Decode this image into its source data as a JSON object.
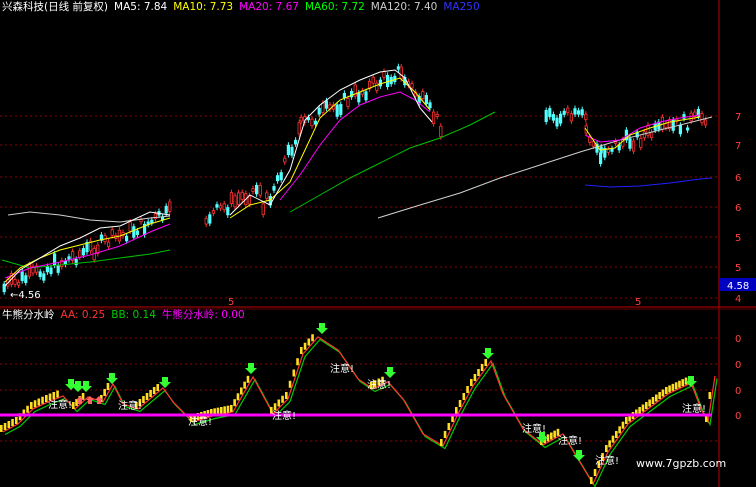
{
  "main_legend": {
    "stock": "兴森科技(日线 前复权)",
    "ma": [
      {
        "label": "MA5:",
        "value": "7.84",
        "color": "#ffffff"
      },
      {
        "label": "MA10:",
        "value": "7.73",
        "color": "#ffff00"
      },
      {
        "label": "MA20:",
        "value": "7.67",
        "color": "#ff00ff"
      },
      {
        "label": "MA60:",
        "value": "7.72",
        "color": "#00ff00"
      },
      {
        "label": "MA120:",
        "value": "7.40",
        "color": "#cccccc"
      },
      {
        "label": "MA250",
        "value": "",
        "color": "#3333ff"
      }
    ]
  },
  "price_axis": {
    "ticks": [
      "7",
      "7",
      "6",
      "6",
      "5",
      "5",
      "4"
    ],
    "current_price": "4.58",
    "low_label": "4.56",
    "marker": "5"
  },
  "indicator_legend": {
    "name": "牛熊分水岭",
    "items": [
      {
        "label": "AA:",
        "value": "0.25",
        "color": "#ff3333"
      },
      {
        "label": "BB:",
        "value": "0.14",
        "color": "#00cc00"
      },
      {
        "label": "牛熊分水岭:",
        "value": "0.00",
        "color": "#ff00ff"
      }
    ]
  },
  "indicator_axis": {
    "ticks": [
      "0",
      "0",
      "0",
      "0"
    ]
  },
  "signals": {
    "warning_label": "注意!"
  },
  "watermark": "www.7gpzb.com",
  "colors": {
    "up": "#ff3232",
    "down": "#54ffff",
    "ma5": "#ffffff",
    "ma10": "#ffff00",
    "ma20": "#ff00ff",
    "ma60": "#00c000",
    "ma120": "#d0d0d0",
    "ma250": "#2020ff",
    "grid": "#8b0000",
    "divider": "#c00000"
  }
}
